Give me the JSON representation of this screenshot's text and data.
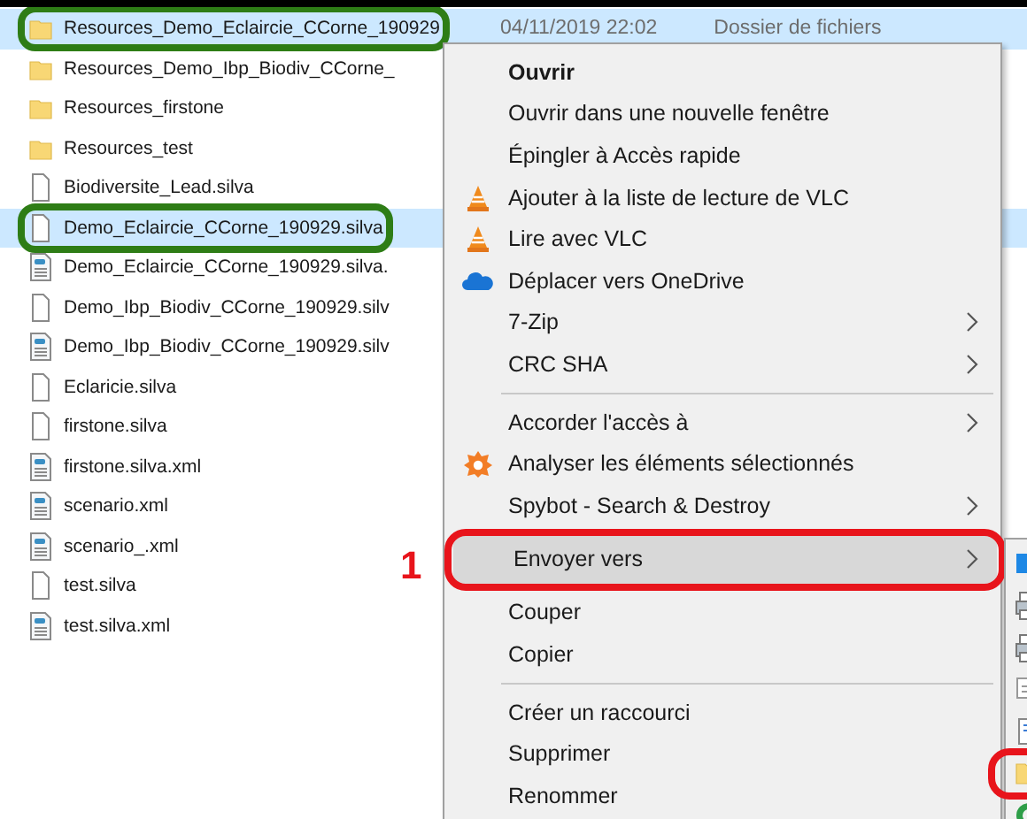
{
  "files": [
    {
      "name": "Resources_Demo_Eclaircie_CCorne_190929",
      "kind": "folder",
      "selected": true,
      "circled": true,
      "date": "04/11/2019 22:02",
      "type": "Dossier de fichiers"
    },
    {
      "name": "Resources_Demo_Ibp_Biodiv_CCorne_",
      "kind": "folder",
      "selected": false,
      "circled": false
    },
    {
      "name": "Resources_firstone",
      "kind": "folder",
      "selected": false,
      "circled": false
    },
    {
      "name": "Resources_test",
      "kind": "folder",
      "selected": false,
      "circled": false
    },
    {
      "name": "Biodiversite_Lead.silva",
      "kind": "file",
      "selected": false,
      "circled": false
    },
    {
      "name": "Demo_Eclaircie_CCorne_190929.silva",
      "kind": "file",
      "selected": true,
      "circled": true
    },
    {
      "name": "Demo_Eclaircie_CCorne_190929.silva.",
      "kind": "xml",
      "selected": false,
      "circled": false
    },
    {
      "name": "Demo_Ibp_Biodiv_CCorne_190929.silv",
      "kind": "file",
      "selected": false,
      "circled": false
    },
    {
      "name": "Demo_Ibp_Biodiv_CCorne_190929.silv",
      "kind": "xml",
      "selected": false,
      "circled": false
    },
    {
      "name": "Eclaricie.silva",
      "kind": "file",
      "selected": false,
      "circled": false
    },
    {
      "name": "firstone.silva",
      "kind": "file",
      "selected": false,
      "circled": false
    },
    {
      "name": "firstone.silva.xml",
      "kind": "xml",
      "selected": false,
      "circled": false
    },
    {
      "name": "scenario.xml",
      "kind": "xml",
      "selected": false,
      "circled": false
    },
    {
      "name": "scenario_.xml",
      "kind": "xml",
      "selected": false,
      "circled": false
    },
    {
      "name": "test.silva",
      "kind": "file",
      "selected": false,
      "circled": false
    },
    {
      "name": "test.silva.xml",
      "kind": "xml",
      "selected": false,
      "circled": false
    }
  ],
  "context_menu": {
    "items": [
      {
        "kind": "plain",
        "label": "Ouvrir",
        "bold": true,
        "submenu": false
      },
      {
        "kind": "plain",
        "label": "Ouvrir dans une nouvelle fenêtre",
        "bold": false,
        "submenu": false
      },
      {
        "kind": "plain",
        "label": "Épingler à Accès rapide",
        "bold": false,
        "submenu": false
      },
      {
        "kind": "vlc",
        "label": "Ajouter à la liste de lecture de VLC",
        "bold": false,
        "submenu": false
      },
      {
        "kind": "vlc",
        "label": "Lire avec VLC",
        "bold": false,
        "submenu": false
      },
      {
        "kind": "cloud",
        "label": "Déplacer vers OneDrive",
        "bold": false,
        "submenu": false
      },
      {
        "kind": "plain",
        "label": "7-Zip",
        "bold": false,
        "submenu": true
      },
      {
        "kind": "plain",
        "label": "CRC SHA",
        "bold": false,
        "submenu": true
      },
      {
        "kind": "separator"
      },
      {
        "kind": "plain",
        "label": "Accorder l'accès à",
        "bold": false,
        "submenu": true
      },
      {
        "kind": "scan",
        "label": "Analyser les éléments sélectionnés",
        "bold": false,
        "submenu": false
      },
      {
        "kind": "plain",
        "label": "Spybot - Search & Destroy",
        "bold": false,
        "submenu": true
      },
      {
        "kind": "plain",
        "label": "Envoyer vers",
        "bold": false,
        "submenu": true,
        "highlighted": true,
        "circled": true,
        "marker": "1"
      },
      {
        "kind": "plain",
        "label": "Couper",
        "bold": false,
        "submenu": false
      },
      {
        "kind": "plain",
        "label": "Copier",
        "bold": false,
        "submenu": false
      },
      {
        "kind": "separator"
      },
      {
        "kind": "plain",
        "label": "Créer un raccourci",
        "bold": false,
        "submenu": false
      },
      {
        "kind": "plain",
        "label": "Supprimer",
        "bold": false,
        "submenu": false
      },
      {
        "kind": "plain",
        "label": "Renommer",
        "bold": false,
        "submenu": false
      }
    ]
  },
  "submenu": {
    "items": [
      {
        "kind": "screen",
        "circled": false
      },
      {
        "kind": "printer",
        "circled": false
      },
      {
        "kind": "printer",
        "circled": false
      },
      {
        "kind": "page",
        "circled": false
      },
      {
        "kind": "document",
        "circled": false
      },
      {
        "kind": "folder",
        "circled": true
      },
      {
        "kind": "ring",
        "circled": false
      }
    ]
  }
}
